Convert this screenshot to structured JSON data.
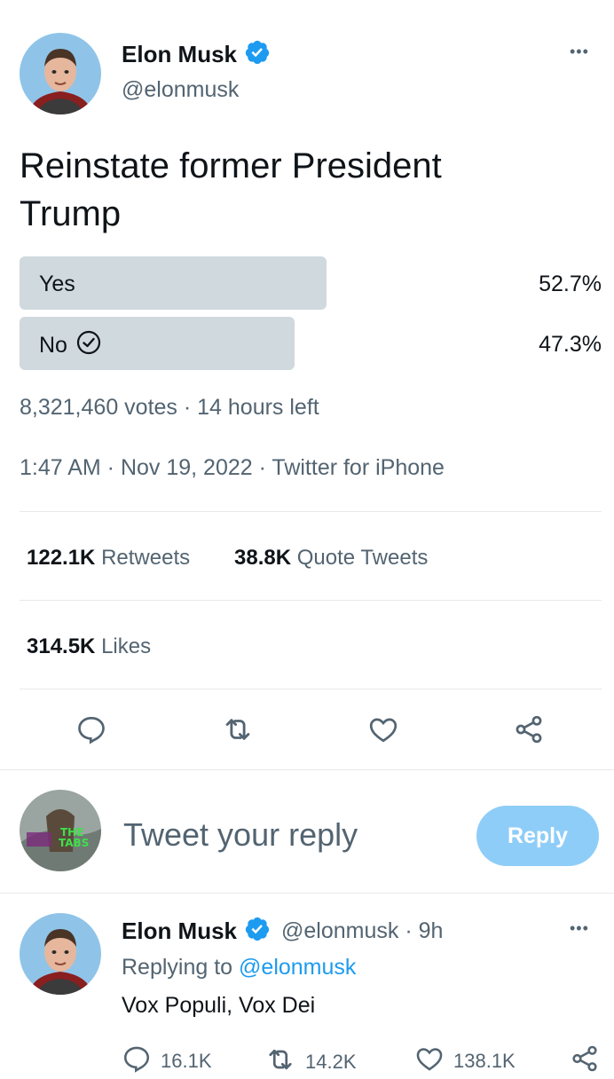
{
  "tweet": {
    "author_name": "Elon Musk",
    "author_handle": "@elonmusk",
    "more_label": "•••",
    "text_line1": "Reinstate former President",
    "text_line2": "Trump",
    "poll": {
      "options": [
        {
          "label": "Yes",
          "percent_text": "52.7%",
          "percent": 52.7,
          "chosen": false
        },
        {
          "label": "No",
          "percent_text": "47.3%",
          "percent": 47.3,
          "chosen": true
        }
      ],
      "summary": "8,321,460 votes · 14 hours left"
    },
    "timestamp": "1:47 AM · Nov 19, 2022 · Twitter for iPhone",
    "stats": {
      "retweets_count": "122.1K",
      "retweets_label": "Retweets",
      "quotes_count": "38.8K",
      "quotes_label": "Quote Tweets",
      "likes_count": "314.5K",
      "likes_label": "Likes"
    },
    "actions": [
      "reply-icon",
      "retweet-icon",
      "like-icon",
      "share-icon"
    ]
  },
  "composer": {
    "placeholder": "Tweet your reply",
    "reply_button": "Reply"
  },
  "reply_tweet": {
    "author_name": "Elon Musk",
    "author_handle_time": "@elonmusk · 9h",
    "more_label": "•••",
    "replying_prefix": "Replying to ",
    "replying_handle": "@elonmusk",
    "text": "Vox Populi, Vox Dei",
    "reply_count": "16.1K",
    "retweet_count": "14.2K",
    "like_count": "138.1K"
  },
  "colors": {
    "accent": "#1d9bf0",
    "reply_button": "#8ecdf8",
    "poll_bar": "#cfd9de",
    "secondary_text": "#536471"
  }
}
